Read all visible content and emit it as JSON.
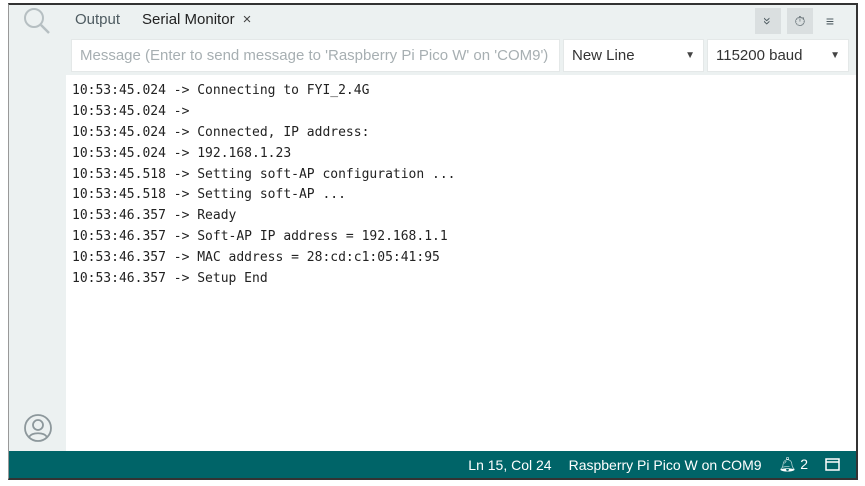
{
  "tabs": {
    "output": "Output",
    "serial": "Serial Monitor",
    "close": "×"
  },
  "toolbar": {
    "autoscroll": "»",
    "timestamp": "⏱",
    "clear": "≡"
  },
  "message": {
    "placeholder": "Message (Enter to send message to 'Raspberry Pi Pico W' on 'COM9')"
  },
  "line_ending": "New Line",
  "baud": "115200 baud",
  "lines": [
    "10:53:45.024 -> Connecting to FYI_2.4G",
    "10:53:45.024 -> ",
    "10:53:45.024 -> Connected, IP address:",
    "10:53:45.024 -> 192.168.1.23",
    "10:53:45.518 -> Setting soft-AP configuration ...",
    "10:53:45.518 -> Setting soft-AP ...",
    "10:53:46.357 -> Ready",
    "10:53:46.357 -> Soft-AP IP address = 192.168.1.1",
    "10:53:46.357 -> MAC address = 28:cd:c1:05:41:95",
    "10:53:46.357 -> Setup End"
  ],
  "status": {
    "position": "Ln 15, Col 24",
    "board": "Raspberry Pi Pico W on COM9",
    "notifications": "2"
  }
}
